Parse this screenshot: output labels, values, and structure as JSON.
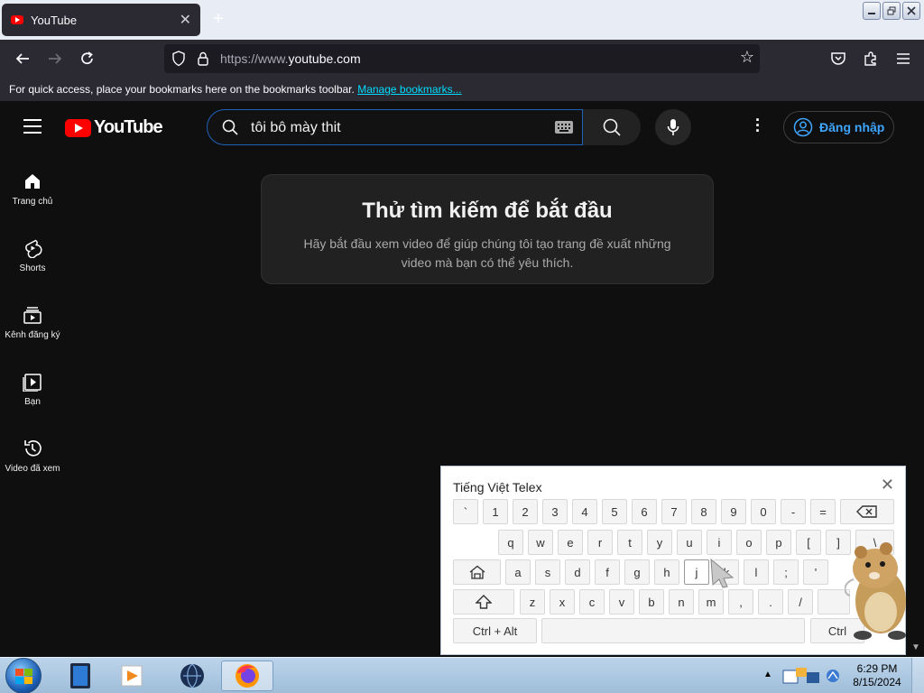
{
  "browser": {
    "tab_title": "YouTube",
    "tab_close": "✕",
    "new_tab": "+",
    "url_prefix": "https://www.",
    "url_domain": "youtube.com",
    "bookmarks_text": "For quick access, place your bookmarks here on the bookmarks toolbar.",
    "bookmarks_link": "Manage bookmarks..."
  },
  "youtube": {
    "logo_text": "YouTube",
    "search_query": "tôi bô mày thit",
    "signin_label": "Đăng nhập",
    "guide": [
      {
        "label": "Trang chủ",
        "icon": "home-icon"
      },
      {
        "label": "Shorts",
        "icon": "shorts-icon"
      },
      {
        "label": "Kênh đăng ký",
        "icon": "subscriptions-icon"
      },
      {
        "label": "Bạn",
        "icon": "you-icon"
      },
      {
        "label": "Video đã xem",
        "icon": "history-icon"
      }
    ],
    "empty_title": "Thử tìm kiếm để bắt đầu",
    "empty_body": "Hãy bắt đầu xem video để giúp chúng tôi tạo trang đề xuất những video mà bạn có thể yêu thích."
  },
  "keyboard": {
    "title": "Tiếng Việt Telex",
    "close": "✕",
    "row1": [
      "`",
      "1",
      "2",
      "3",
      "4",
      "5",
      "6",
      "7",
      "8",
      "9",
      "0",
      "-",
      "="
    ],
    "row2": [
      "q",
      "w",
      "e",
      "r",
      "t",
      "y",
      "u",
      "i",
      "o",
      "p",
      "[",
      "]",
      "\\"
    ],
    "row3": [
      "a",
      "s",
      "d",
      "f",
      "g",
      "h",
      "j",
      "k",
      "l",
      ";",
      "'"
    ],
    "row4": [
      "z",
      "x",
      "c",
      "v",
      "b",
      "n",
      "m",
      ",",
      ".",
      "/"
    ],
    "ctrl_alt": "Ctrl + Alt",
    "ctrl_right": "Ctrl"
  },
  "taskbar": {
    "time": "6:29 PM",
    "date": "8/15/2024",
    "tray_arrow": "▲"
  },
  "colors": {
    "yt_bg": "#0f0f0f",
    "yt_red": "#ff0000",
    "signin_blue": "#3ea6ff",
    "search_border": "#1c62b9"
  }
}
